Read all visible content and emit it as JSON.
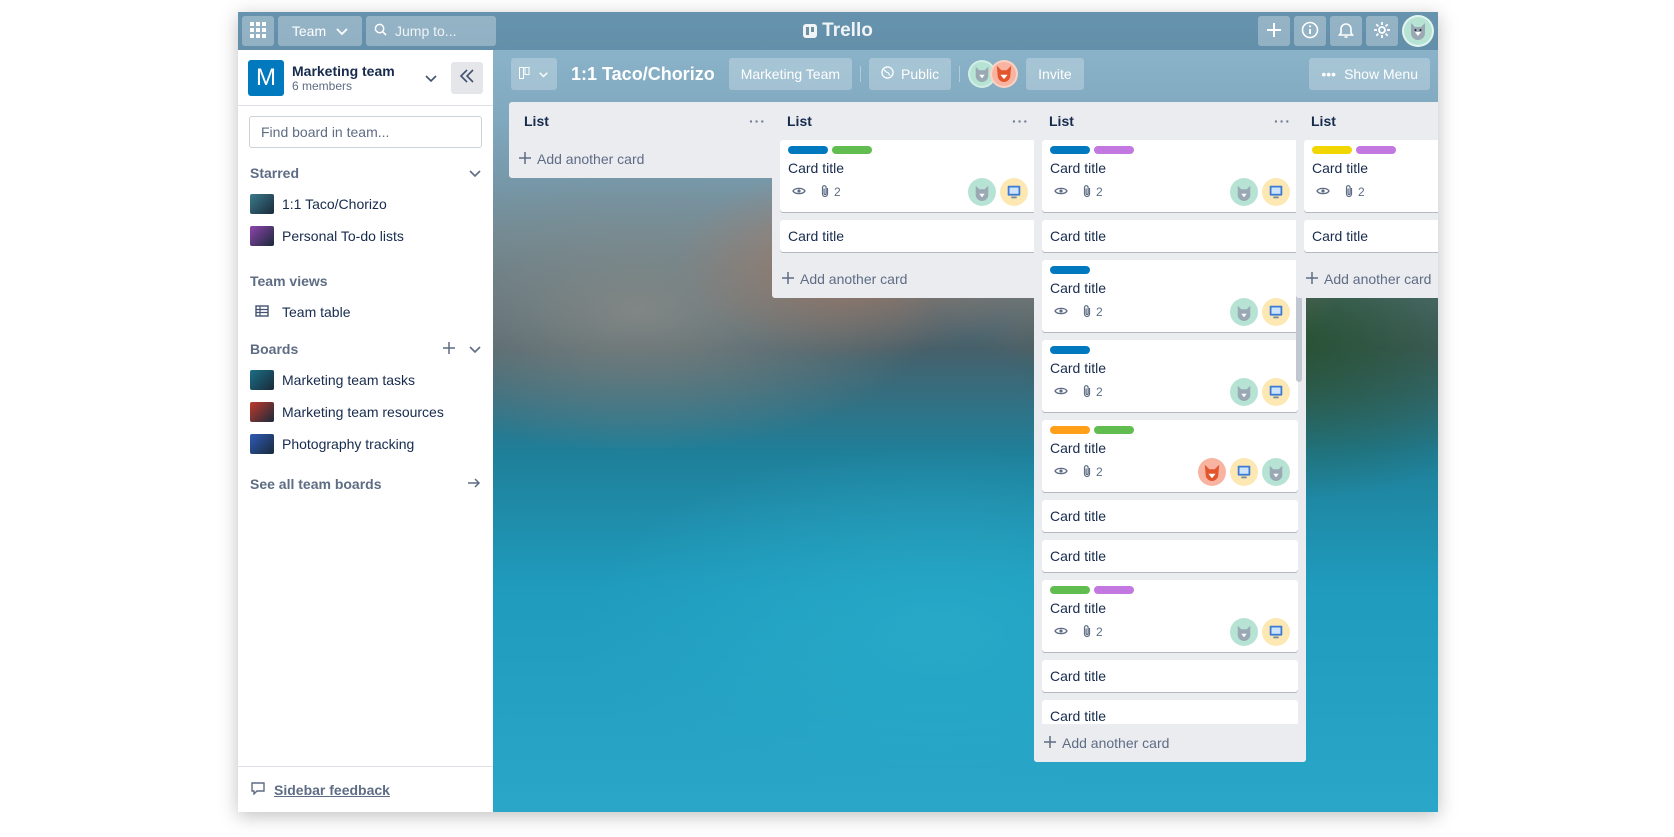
{
  "topbar": {
    "apps_icon": "grid-icon",
    "team_label": "Team",
    "search_placeholder": "Jump to...",
    "logo_text": "Trello",
    "right_icons": [
      "plus-icon",
      "info-icon",
      "bell-icon",
      "gear-icon"
    ]
  },
  "sidebar": {
    "team_initial": "M",
    "team_name": "Marketing team",
    "team_members": "6 members",
    "search_placeholder": "Find board in team...",
    "starred_title": "Starred",
    "starred": [
      {
        "label": "1:1 Taco/Chorizo",
        "color": "#3a7b8c"
      },
      {
        "label": "Personal To-do lists",
        "color": "#8e44ad"
      }
    ],
    "views_title": "Team views",
    "views": [
      {
        "label": "Team table"
      }
    ],
    "boards_title": "Boards",
    "boards": [
      {
        "label": "Marketing team tasks",
        "color": "#1b6f86"
      },
      {
        "label": "Marketing team resources",
        "color": "#c0392b"
      },
      {
        "label": "Photography tracking",
        "color": "#2d5bb8"
      }
    ],
    "see_all": "See all team boards",
    "feedback": "Sidebar feedback"
  },
  "board": {
    "title": "1:1 Taco/Chorizo",
    "team_button": "Marketing Team",
    "visibility": "Public",
    "invite": "Invite",
    "show_menu": "Show Menu"
  },
  "lists": [
    {
      "title": "List",
      "add": "Add another card",
      "cards": []
    },
    {
      "title": "List",
      "add": "Add another card",
      "cards": [
        {
          "title": "Card title",
          "labels": [
            "#0079bf",
            "#61bd4f"
          ],
          "badges": true,
          "attachments": "2",
          "avatars": [
            "husky",
            "comp"
          ]
        },
        {
          "title": "Card title",
          "labels": [],
          "badges": false,
          "attachments": "",
          "avatars": []
        }
      ]
    },
    {
      "title": "List",
      "add": "Add another card",
      "cards": [
        {
          "title": "Card title",
          "labels": [
            "#0079bf",
            "#c377e0"
          ],
          "badges": true,
          "attachments": "2",
          "avatars": [
            "husky",
            "comp"
          ]
        },
        {
          "title": "Card title",
          "labels": [],
          "badges": false,
          "attachments": "",
          "avatars": []
        },
        {
          "title": "Card title",
          "labels": [
            "#0079bf"
          ],
          "badges": true,
          "attachments": "2",
          "avatars": [
            "husky",
            "comp"
          ]
        },
        {
          "title": "Card title",
          "labels": [
            "#0079bf"
          ],
          "badges": true,
          "attachments": "2",
          "avatars": [
            "husky",
            "comp"
          ]
        },
        {
          "title": "Card title",
          "labels": [
            "#ff9f1a",
            "#61bd4f"
          ],
          "badges": true,
          "attachments": "2",
          "avatars": [
            "fox",
            "comp",
            "husky"
          ]
        },
        {
          "title": "Card title",
          "labels": [],
          "badges": false,
          "attachments": "",
          "avatars": []
        },
        {
          "title": "Card title",
          "labels": [],
          "badges": false,
          "attachments": "",
          "avatars": []
        },
        {
          "title": "Card title",
          "labels": [
            "#61bd4f",
            "#c377e0"
          ],
          "badges": true,
          "attachments": "2",
          "avatars": [
            "husky",
            "comp"
          ]
        },
        {
          "title": "Card title",
          "labels": [],
          "badges": false,
          "attachments": "",
          "avatars": []
        },
        {
          "title": "Card title",
          "labels": [],
          "badges": false,
          "attachments": "",
          "avatars": []
        },
        {
          "title": "",
          "labels": [
            "#ff9f1a",
            "#ff78cb"
          ],
          "badges": false,
          "attachments": "",
          "avatars": []
        }
      ]
    },
    {
      "title": "List",
      "add": "Add another card",
      "cards": [
        {
          "title": "Card title",
          "labels": [
            "#f2d600",
            "#c377e0"
          ],
          "badges": true,
          "attachments": "2",
          "avatars": []
        },
        {
          "title": "Card title",
          "labels": [],
          "badges": false,
          "attachments": "",
          "avatars": []
        }
      ]
    }
  ]
}
